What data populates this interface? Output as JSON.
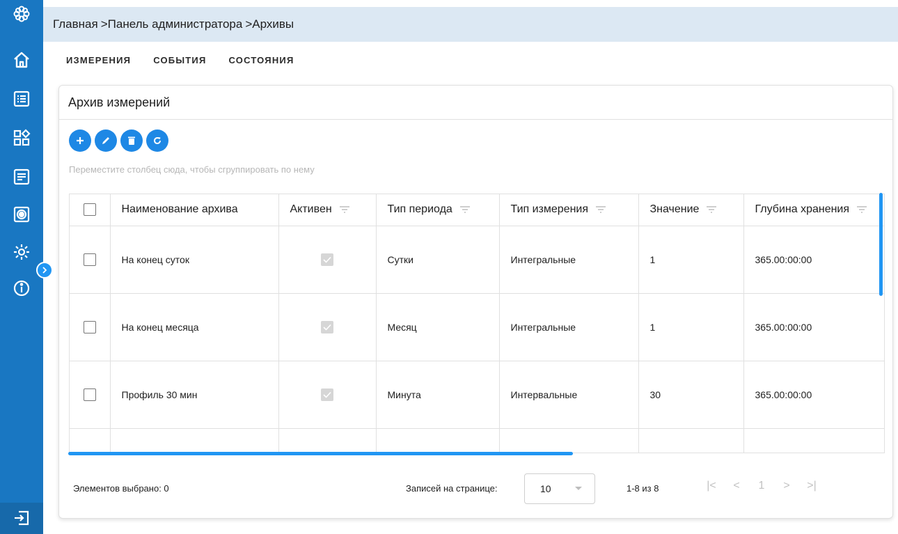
{
  "sidebar": {
    "icons": [
      "app-logo-icon",
      "home-icon",
      "list-icon",
      "widgets-icon",
      "document-icon",
      "settings-box-icon",
      "gear-icon",
      "info-icon",
      "exit-icon"
    ]
  },
  "breadcrumb": {
    "items": [
      "Главная",
      ">Панель администратора",
      ">Архивы"
    ]
  },
  "tabs": [
    "ИЗМЕРЕНИЯ",
    "СОБЫТИЯ",
    "СОСТОЯНИЯ"
  ],
  "card": {
    "title": "Архив измерений",
    "group_hint": "Переместите столбец сюда, чтобы сгруппировать по нему"
  },
  "toolbar": {
    "buttons": [
      "add-icon",
      "edit-icon",
      "delete-icon",
      "refresh-icon"
    ]
  },
  "table": {
    "headers": [
      "Наименование архива",
      "Активен",
      "Тип периода",
      "Тип измерения",
      "Значение",
      "Глубина хранения"
    ],
    "rows": [
      {
        "name": "На конец суток",
        "active": true,
        "period": "Сутки",
        "measure": "Интегральные",
        "value": "1",
        "depth": "365.00:00:00"
      },
      {
        "name": "На конец месяца",
        "active": true,
        "period": "Месяц",
        "measure": "Интегральные",
        "value": "1",
        "depth": "365.00:00:00"
      },
      {
        "name": "Профиль 30 мин",
        "active": true,
        "period": "Минута",
        "measure": "Интервальные",
        "value": "30",
        "depth": "365.00:00:00"
      }
    ]
  },
  "footer": {
    "selected": "Элементов выбрано: 0",
    "rows_per_page_label": "Записей на странице:",
    "rows_per_page": "10",
    "range": "1-8 из 8",
    "page": "1"
  },
  "colors": {
    "sidebar": "#1977c2",
    "accent": "#1e88e5",
    "topbar": "#dce8f3"
  }
}
